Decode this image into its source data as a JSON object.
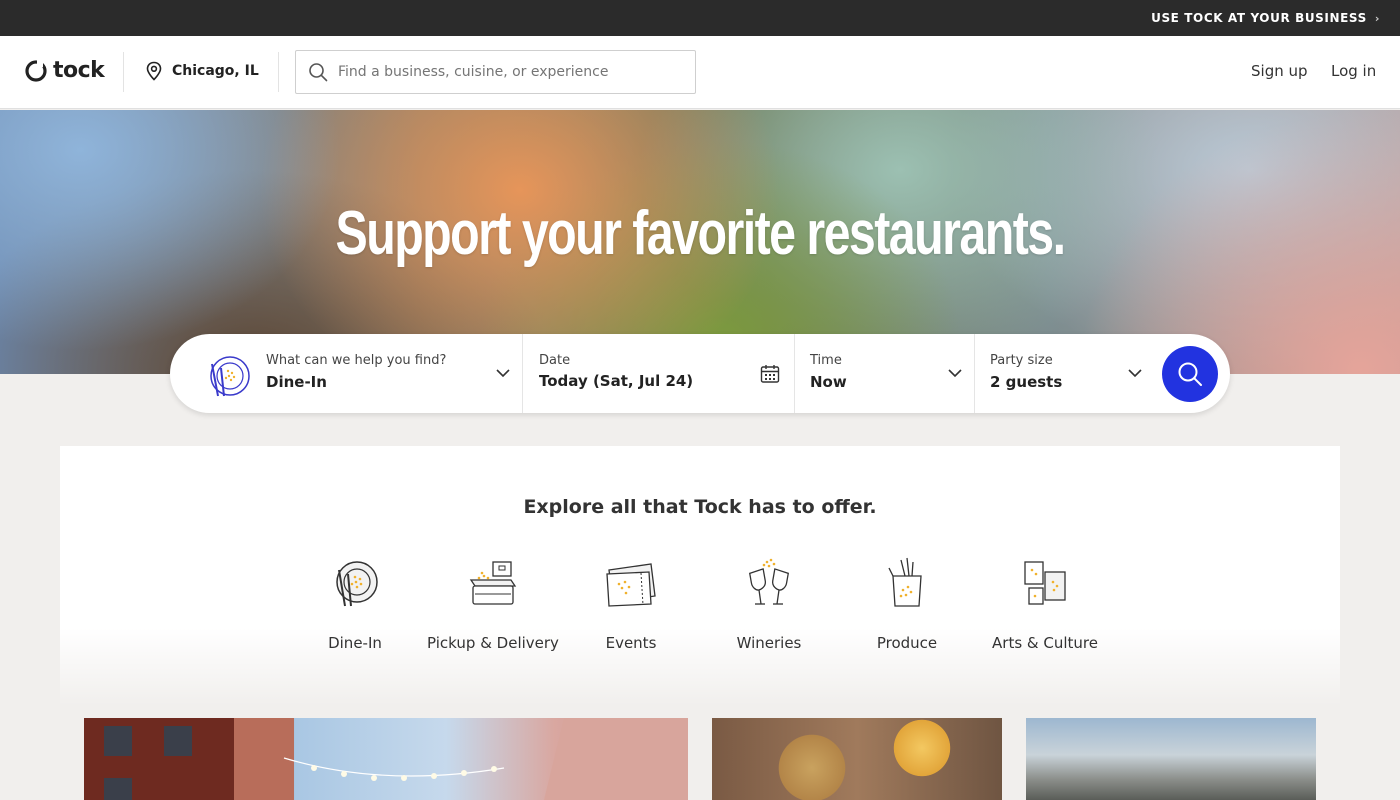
{
  "topbar": {
    "business_link": "USE TOCK AT YOUR BUSINESS",
    "chevron_icon": "chevron-right-icon"
  },
  "header": {
    "logo_text": "tock",
    "location": "Chicago, IL",
    "search_placeholder": "Find a business, cuisine, or experience",
    "sign_up": "Sign up",
    "log_in": "Log in"
  },
  "hero": {
    "title": "Support your favorite restaurants."
  },
  "booking": {
    "experience": {
      "label": "What can we help you find?",
      "value": "Dine-In"
    },
    "date": {
      "label": "Date",
      "value": "Today (Sat, Jul 24)"
    },
    "time": {
      "label": "Time",
      "value": "Now"
    },
    "party": {
      "label": "Party size",
      "value": "2 guests"
    },
    "accent_color": "#2233e0"
  },
  "explore": {
    "title": "Explore all that Tock has to offer.",
    "categories": [
      {
        "label": "Dine-In",
        "icon": "dine-in-icon"
      },
      {
        "label": "Pickup & Delivery",
        "icon": "pickup-delivery-icon"
      },
      {
        "label": "Events",
        "icon": "events-ticket-icon"
      },
      {
        "label": "Wineries",
        "icon": "wineries-icon"
      },
      {
        "label": "Produce",
        "icon": "produce-icon"
      },
      {
        "label": "Arts & Culture",
        "icon": "arts-culture-icon"
      }
    ]
  }
}
